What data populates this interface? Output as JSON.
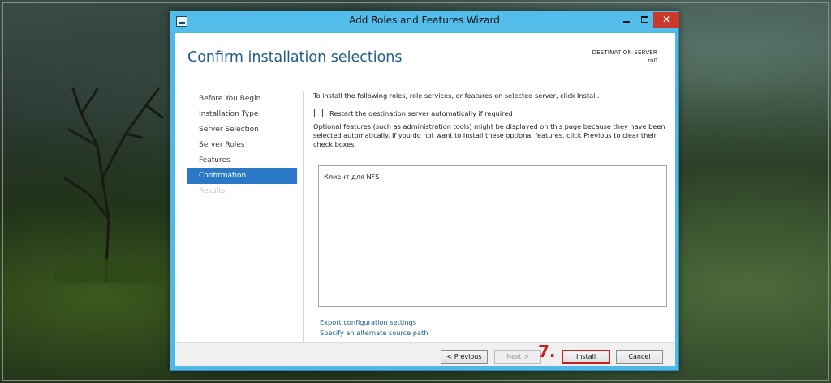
{
  "window": {
    "title": "Add Roles and Features Wizard",
    "minimize_glyph": "",
    "maximize_glyph": "",
    "close_glyph": "✕"
  },
  "page": {
    "title": "Confirm installation selections",
    "destination_label": "DESTINATION SERVER",
    "destination_value": "ru0"
  },
  "nav": {
    "items": [
      {
        "label": "Before You Begin",
        "state": "normal"
      },
      {
        "label": "Installation Type",
        "state": "normal"
      },
      {
        "label": "Server Selection",
        "state": "normal"
      },
      {
        "label": "Server Roles",
        "state": "normal"
      },
      {
        "label": "Features",
        "state": "normal"
      },
      {
        "label": "Confirmation",
        "state": "active"
      },
      {
        "label": "Results",
        "state": "disabled"
      }
    ]
  },
  "content": {
    "intro": "To install the following roles, role services, or features on selected server, click Install.",
    "restart_checkbox": {
      "label": "Restart the destination server automatically if required",
      "checked": false
    },
    "optional_note": "Optional features (such as administration tools) might be displayed on this page because they have been selected automatically. If you do not want to install these optional features, click Previous to clear their check boxes.",
    "features": [
      "Клиент для NFS"
    ],
    "links": {
      "export": "Export configuration settings",
      "alternate": "Specify an alternate source path"
    }
  },
  "footer": {
    "previous": "< Previous",
    "next": "Next >",
    "install": "Install",
    "cancel": "Cancel"
  },
  "annotation": {
    "step": "7."
  },
  "colors": {
    "titlebar": "#52bdea",
    "accent": "#2b79c6",
    "link": "#1f5e8c",
    "highlight": "#d01c1c",
    "close_button": "#c8392c"
  }
}
